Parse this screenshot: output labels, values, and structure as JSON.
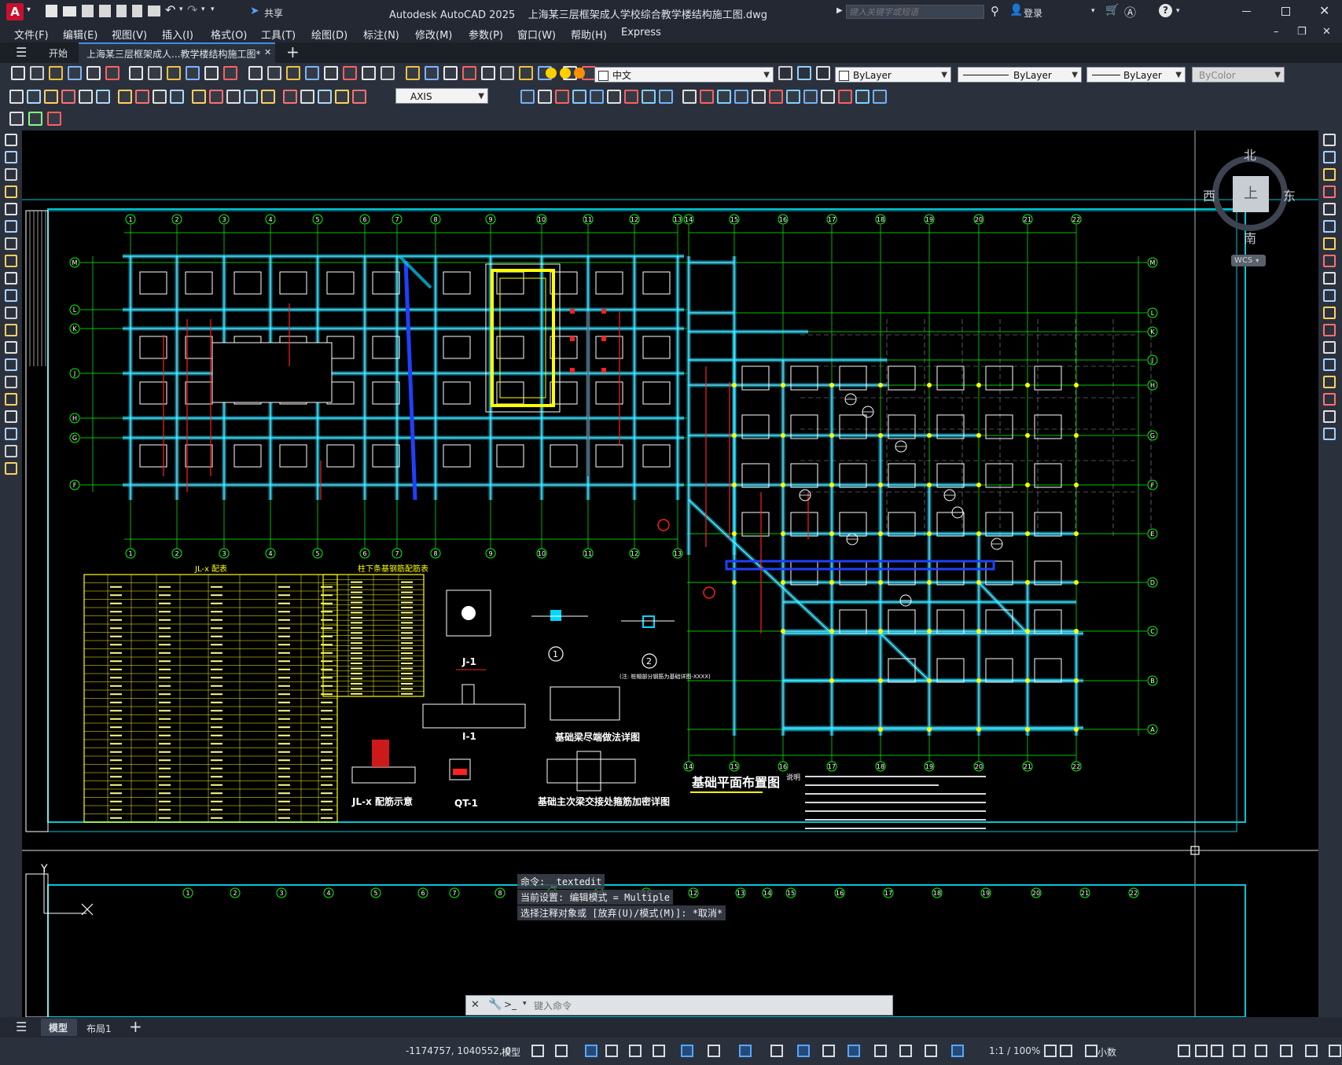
{
  "app": {
    "window_title": "Autodesk AutoCAD 2025    上海某三层框架成人学校综合教学楼结构施工图.dwg",
    "share_label": "共享",
    "search_placeholder": "键入关键字或短语",
    "login_label": "登录"
  },
  "menu": [
    "文件(F)",
    "编辑(E)",
    "视图(V)",
    "插入(I)",
    "格式(O)",
    "工具(T)",
    "绘图(D)",
    "标注(N)",
    "修改(M)",
    "参数(P)",
    "窗口(W)",
    "帮助(H)",
    "Express"
  ],
  "tabs": {
    "start": "开始",
    "document": "上海某三层框架成人...教学楼结构施工图*"
  },
  "ribbon": {
    "layer_value": "中文",
    "color_value": "ByLayer",
    "linetype_value": "ByLayer",
    "lineweight_value": "ByLayer",
    "plotstyle_value": "ByColor",
    "dimstyle_value": "AXIS"
  },
  "viewcube": {
    "north": "北",
    "south": "南",
    "east": "东",
    "west": "西",
    "top": "上",
    "wcs": "WCS"
  },
  "drawing": {
    "title_plan": "基础平面布置图",
    "table1_title": "JL-x 配表",
    "table2_title": "柱下条基钢筋配筋表",
    "detail_j1": "J-1",
    "detail_i1": "I-1",
    "detail_qt1": "QT-1",
    "detail_jl": "JL-x 配筋示意",
    "detail_beam_end": "基础梁尽端做法详图",
    "detail_junction": "基础主次梁交接处箍筋加密详图",
    "note_lead": "说明",
    "detail_note": "(注: 桩帽部分钢筋为基础详图-XXXX)",
    "top_axes": [
      "1",
      "2",
      "3",
      "4",
      "5",
      "6",
      "7",
      "8",
      "9",
      "10",
      "11",
      "12",
      "13",
      "14",
      "15",
      "16",
      "17",
      "18",
      "19",
      "20",
      "21",
      "22"
    ],
    "left_axes": [
      "M",
      "L",
      "K",
      "J",
      "H",
      "G",
      "F"
    ],
    "right_axes": [
      "M",
      "L",
      "K",
      "J",
      "H",
      "G",
      "F",
      "E",
      "D",
      "C",
      "B",
      "A"
    ],
    "bottom_axes": [
      "1",
      "2",
      "3",
      "4",
      "5",
      "6",
      "7",
      "8",
      "9",
      "10",
      "11",
      "12",
      "13",
      "14",
      "15",
      "16",
      "17",
      "18",
      "19",
      "20",
      "21",
      "22"
    ],
    "lower_axes": [
      "1",
      "2",
      "3",
      "4",
      "5",
      "6",
      "7",
      "8",
      "9",
      "10",
      "11",
      "12",
      "13",
      "14",
      "15",
      "16",
      "17",
      "18",
      "19",
      "20",
      "21",
      "22"
    ],
    "table1_rows": 30,
    "ucs_label": "Y"
  },
  "command": {
    "line1": "命令: _textedit",
    "line2": "当前设置: 编辑模式 = Multiple",
    "line3": "选择注释对象或 [放弃(U)/模式(M)]: *取消*",
    "input_placeholder": "键入命令"
  },
  "layouts": {
    "model": "模型",
    "layout1": "布局1"
  },
  "status": {
    "coords": "-1174757, 1040552, 0",
    "model_label": "模型",
    "scale": "1:1 / 100%",
    "units": "小数"
  },
  "colors": {
    "accent": "#00c8d8",
    "grid": "#00ff00",
    "wall": "#00e5ff",
    "highlight": "#ffff00"
  }
}
